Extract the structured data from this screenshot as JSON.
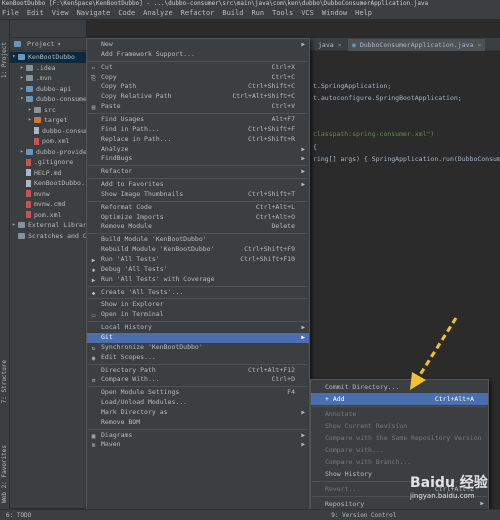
{
  "title": "KenBootDubbo [F:\\KenSpace\\KenBootDubbo] - ...\\dubbo-consumer\\src\\main\\java\\com\\ken\\dubbo\\DubboConsumerApplication.java",
  "menubar": [
    "File",
    "Edit",
    "View",
    "Navigate",
    "Code",
    "Analyze",
    "Refactor",
    "Build",
    "Run",
    "Tools",
    "VCS",
    "Window",
    "Help"
  ],
  "left_tabs": {
    "project": "1: Project",
    "structure": "7: Structure",
    "favorites": "2: Favorites",
    "web": "Web"
  },
  "project_header": {
    "label": "Project"
  },
  "tree": [
    {
      "label": "KenBootDubbo",
      "arrow": "▾",
      "type": "folder-blue",
      "indent": 0,
      "selected": true
    },
    {
      "label": ".idea",
      "arrow": "▸",
      "type": "folder",
      "indent": 1
    },
    {
      "label": ".mvn",
      "arrow": "▸",
      "type": "folder",
      "indent": 1
    },
    {
      "label": "dubbo-api",
      "arrow": "▸",
      "type": "folder-blue",
      "indent": 1
    },
    {
      "label": "dubbo-consumer",
      "arrow": "▾",
      "type": "folder-blue",
      "indent": 1
    },
    {
      "label": "src",
      "arrow": "▸",
      "type": "folder",
      "indent": 2
    },
    {
      "label": "target",
      "arrow": "▸",
      "type": "folder-orange",
      "indent": 2
    },
    {
      "label": "dubbo-consumer.iml",
      "arrow": "",
      "type": "file",
      "indent": 2
    },
    {
      "label": "pom.xml",
      "arrow": "",
      "type": "file-red",
      "indent": 2
    },
    {
      "label": "dubbo-provider",
      "arrow": "▸",
      "type": "folder-blue",
      "indent": 1
    },
    {
      "label": ".gitignore",
      "arrow": "",
      "type": "file-red",
      "indent": 1
    },
    {
      "label": "HELP.md",
      "arrow": "",
      "type": "file",
      "indent": 1
    },
    {
      "label": "KenBootDubbo.iml",
      "arrow": "",
      "type": "file",
      "indent": 1
    },
    {
      "label": "mvnw",
      "arrow": "",
      "type": "file-red",
      "indent": 1
    },
    {
      "label": "mvnw.cmd",
      "arrow": "",
      "type": "file-red",
      "indent": 1
    },
    {
      "label": "pom.xml",
      "arrow": "",
      "type": "file-red",
      "indent": 1
    },
    {
      "label": "External Libraries",
      "arrow": "▸",
      "type": "folder",
      "indent": 0
    },
    {
      "label": "Scratches and Consoles",
      "arrow": "",
      "type": "folder",
      "indent": 0
    }
  ],
  "editor_tabs": [
    {
      "label": "java",
      "active": false
    },
    {
      "label": "DubboConsumerApplication.java",
      "active": true
    }
  ],
  "code": [
    {
      "text": "t.SpringApplication;"
    },
    {
      "text": "t.autoconfigure.SpringBootApplication;"
    },
    {
      "text": "classpath:spring-consumer.xml\")"
    },
    {
      "text": "{"
    },
    {
      "text": "ring[] args) { SpringApplication.run(DubboConsumer"
    }
  ],
  "context_menu": {
    "items": [
      {
        "label": "New",
        "shortcut": "",
        "submenu": true,
        "icon": ""
      },
      {
        "label": "Add Framework Support...",
        "shortcut": "",
        "submenu": false,
        "icon": ""
      },
      {
        "sep": true
      },
      {
        "label": "Cut",
        "shortcut": "Ctrl+X",
        "submenu": false,
        "icon": "✂"
      },
      {
        "label": "Copy",
        "shortcut": "Ctrl+C",
        "submenu": false,
        "icon": "⎘"
      },
      {
        "label": "Copy Path",
        "shortcut": "Ctrl+Shift+C",
        "submenu": false,
        "icon": ""
      },
      {
        "label": "Copy Relative Path",
        "shortcut": "Ctrl+Alt+Shift+C",
        "submenu": false,
        "icon": ""
      },
      {
        "label": "Paste",
        "shortcut": "Ctrl+V",
        "submenu": false,
        "icon": "▤"
      },
      {
        "sep": true
      },
      {
        "label": "Find Usages",
        "shortcut": "Alt+F7",
        "submenu": false,
        "icon": ""
      },
      {
        "label": "Find in Path...",
        "shortcut": "Ctrl+Shift+F",
        "submenu": false,
        "icon": ""
      },
      {
        "label": "Replace in Path...",
        "shortcut": "Ctrl+Shift+R",
        "submenu": false,
        "icon": ""
      },
      {
        "label": "Analyze",
        "shortcut": "",
        "submenu": true,
        "icon": ""
      },
      {
        "label": "FindBugs",
        "shortcut": "",
        "submenu": true,
        "icon": ""
      },
      {
        "sep": true
      },
      {
        "label": "Refactor",
        "shortcut": "",
        "submenu": true,
        "icon": ""
      },
      {
        "sep": true
      },
      {
        "label": "Add to Favorites",
        "shortcut": "",
        "submenu": true,
        "icon": ""
      },
      {
        "label": "Show Image Thumbnails",
        "shortcut": "Ctrl+Shift+T",
        "submenu": false,
        "icon": ""
      },
      {
        "sep": true
      },
      {
        "label": "Reformat Code",
        "shortcut": "Ctrl+Alt+L",
        "submenu": false,
        "icon": ""
      },
      {
        "label": "Optimize Imports",
        "shortcut": "Ctrl+Alt+O",
        "submenu": false,
        "icon": ""
      },
      {
        "label": "Remove Module",
        "shortcut": "Delete",
        "submenu": false,
        "icon": ""
      },
      {
        "sep": true
      },
      {
        "label": "Build Module 'KenBootDubbo'",
        "shortcut": "",
        "submenu": false,
        "icon": ""
      },
      {
        "label": "Rebuild Module 'KenBootDubbo'",
        "shortcut": "Ctrl+Shift+F9",
        "submenu": false,
        "icon": ""
      },
      {
        "label": "Run 'All Tests'",
        "shortcut": "Ctrl+Shift+F10",
        "submenu": false,
        "icon": "▶"
      },
      {
        "label": "Debug 'All Tests'",
        "shortcut": "",
        "submenu": false,
        "icon": "✱"
      },
      {
        "label": "Run 'All Tests' with Coverage",
        "shortcut": "",
        "submenu": false,
        "icon": "▶"
      },
      {
        "sep": true
      },
      {
        "label": "Create 'All Tests'...",
        "shortcut": "",
        "submenu": false,
        "icon": "◆"
      },
      {
        "sep": true
      },
      {
        "label": "Show in Explorer",
        "shortcut": "",
        "submenu": false,
        "icon": ""
      },
      {
        "label": "Open in Terminal",
        "shortcut": "",
        "submenu": false,
        "icon": "▭"
      },
      {
        "sep": true
      },
      {
        "label": "Local History",
        "shortcut": "",
        "submenu": true,
        "icon": ""
      },
      {
        "label": "Git",
        "shortcut": "",
        "submenu": true,
        "icon": "",
        "highlighted": true
      },
      {
        "label": "Synchronize 'KenBootDubbo'",
        "shortcut": "",
        "submenu": false,
        "icon": "↻"
      },
      {
        "label": "Edit Scopes...",
        "shortcut": "",
        "submenu": false,
        "icon": "◉"
      },
      {
        "sep": true
      },
      {
        "label": "Directory Path",
        "shortcut": "Ctrl+Alt+F12",
        "submenu": false,
        "icon": ""
      },
      {
        "label": "Compare With...",
        "shortcut": "Ctrl+D",
        "submenu": false,
        "icon": "⇄"
      },
      {
        "sep": true
      },
      {
        "label": "Open Module Settings",
        "shortcut": "F4",
        "submenu": false,
        "icon": ""
      },
      {
        "label": "Load/Unload Modules...",
        "shortcut": "",
        "submenu": false,
        "icon": ""
      },
      {
        "label": "Mark Directory as",
        "shortcut": "",
        "submenu": true,
        "icon": ""
      },
      {
        "label": "Remove BOM",
        "shortcut": "",
        "submenu": false,
        "icon": ""
      },
      {
        "sep": true
      },
      {
        "label": "Diagrams",
        "shortcut": "",
        "submenu": true,
        "icon": "▦"
      },
      {
        "label": "Maven",
        "shortcut": "",
        "submenu": true,
        "icon": "m"
      }
    ]
  },
  "git_submenu": {
    "items": [
      {
        "label": "Commit Directory...",
        "shortcut": "",
        "submenu": false,
        "disabled": false
      },
      {
        "label": "+ Add",
        "shortcut": "Ctrl+Alt+A",
        "submenu": false,
        "disabled": false,
        "highlighted": true
      },
      {
        "sep": true
      },
      {
        "label": "Annotate",
        "shortcut": "",
        "submenu": false,
        "disabled": true
      },
      {
        "label": "Show Current Revision",
        "shortcut": "",
        "submenu": false,
        "disabled": true
      },
      {
        "label": "Compare with the Same Repository Version",
        "shortcut": "",
        "submenu": false,
        "disabled": true
      },
      {
        "label": "Compare with...",
        "shortcut": "",
        "submenu": false,
        "disabled": true
      },
      {
        "label": "Compare with Branch...",
        "shortcut": "",
        "submenu": false,
        "disabled": true
      },
      {
        "label": "Show History",
        "shortcut": "",
        "submenu": false,
        "disabled": false
      },
      {
        "sep": true
      },
      {
        "label": "Revert...",
        "shortcut": "Ctrl+Alt+Z",
        "submenu": false,
        "disabled": true
      },
      {
        "sep": true
      },
      {
        "label": "Repository",
        "shortcut": "",
        "submenu": true,
        "disabled": false
      }
    ]
  },
  "statusbar": {
    "todo": "6: TODO",
    "vcs": "9: Version Control"
  },
  "watermark": {
    "top": "Baidu 经验",
    "bottom": "jingyan.baidu.com"
  },
  "colors": {
    "highlight": "#4b6eaf",
    "arrow": "#f2c230"
  }
}
